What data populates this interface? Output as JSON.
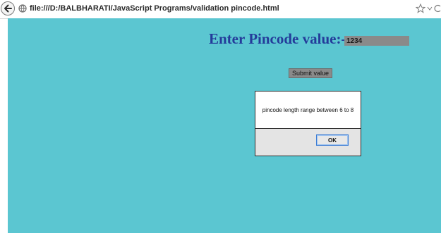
{
  "browser": {
    "url": "file:///D:/BALBHARATI/JavaScript Programs/validation pincode.html",
    "icons": [
      "back-arrow-icon",
      "page-globe-icon",
      "bookmark-star-icon",
      "dropdown-arrow-icon",
      "reload-icon"
    ]
  },
  "page": {
    "prompt_label": "Enter Pincode value:-",
    "pincode_value": "1234",
    "submit_label": "Submit value",
    "background_color": "#5bc6d1",
    "label_color": "#243c9a",
    "control_color": "#8a8a8a"
  },
  "alert": {
    "message": "pincode length range between 6 to 8",
    "ok_label": "OK"
  }
}
